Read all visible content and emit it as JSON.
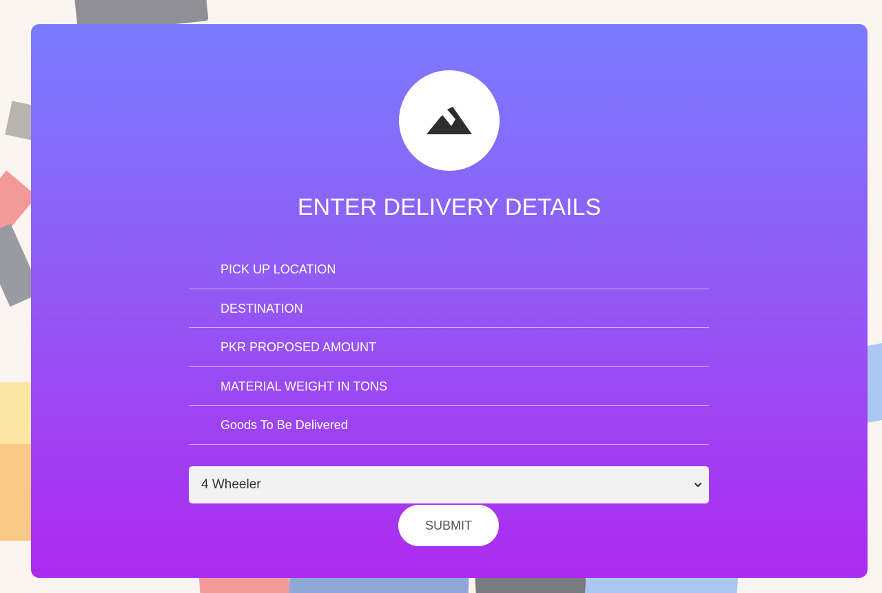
{
  "form": {
    "title": "ENTER DELIVERY DETAILS",
    "fields": [
      {
        "placeholder": "PICK UP LOCATION",
        "value": ""
      },
      {
        "placeholder": "DESTINATION",
        "value": ""
      },
      {
        "placeholder": "PKR PROPOSED AMOUNT",
        "value": ""
      },
      {
        "placeholder": "MATERIAL WEIGHT IN TONS",
        "value": ""
      },
      {
        "placeholder": "Goods To Be Delivered",
        "value": ""
      }
    ],
    "vehicle_select": {
      "selected": "4 Wheeler"
    },
    "submit_label": "SUBMIT"
  },
  "icons": {
    "logo": "mountains-icon",
    "select_arrow": "chevron-down-icon"
  },
  "colors": {
    "gradient_top": "#7a7bfd",
    "gradient_bottom": "#ad2aef",
    "page_background": "#fcf4f1"
  }
}
